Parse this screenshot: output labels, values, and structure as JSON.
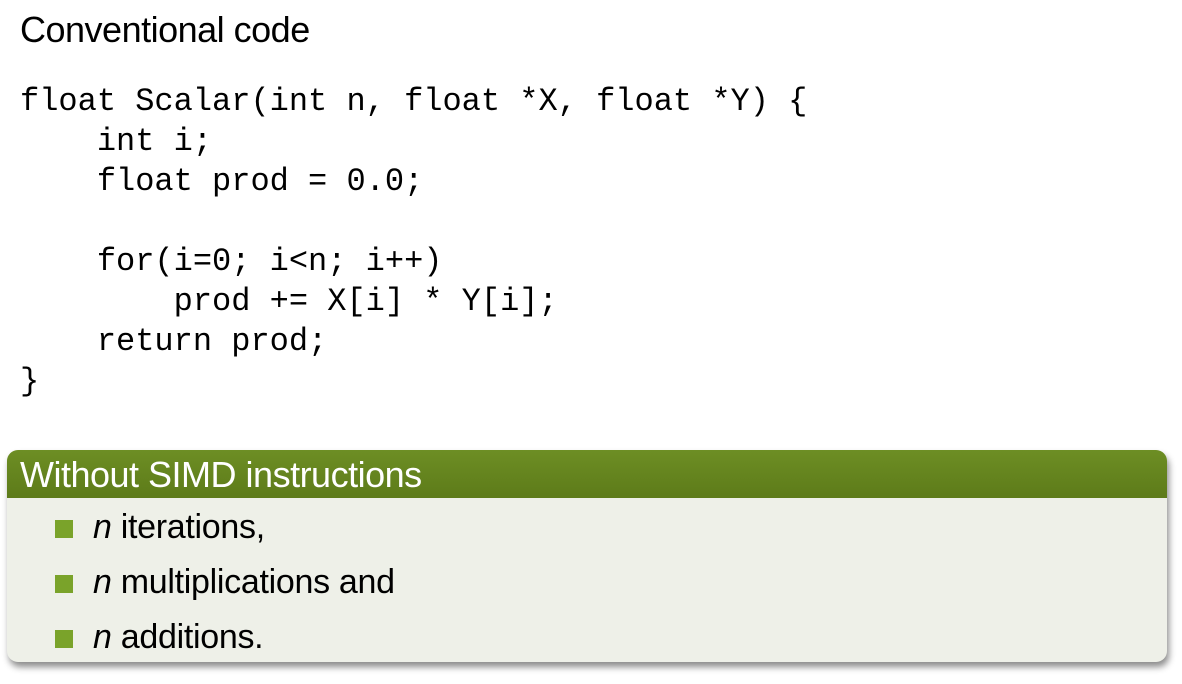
{
  "heading": "Conventional code",
  "code_lines": [
    "float Scalar(int n, float *X, float *Y) {",
    "    int i;",
    "    float prod = 0.0;",
    "",
    "    for(i=0; i<n; i++)",
    "        prod += X[i] * Y[i];",
    "    return prod;",
    "}"
  ],
  "block": {
    "title": "Without SIMD instructions",
    "items": [
      {
        "var": "n",
        "text": " iterations,"
      },
      {
        "var": "n",
        "text": " multiplications and"
      },
      {
        "var": "n",
        "text": " additions."
      }
    ]
  },
  "colors": {
    "block_title_bg": "#5f7d1a",
    "block_body_bg": "#eef0e8",
    "bullet": "#7aa32a"
  }
}
